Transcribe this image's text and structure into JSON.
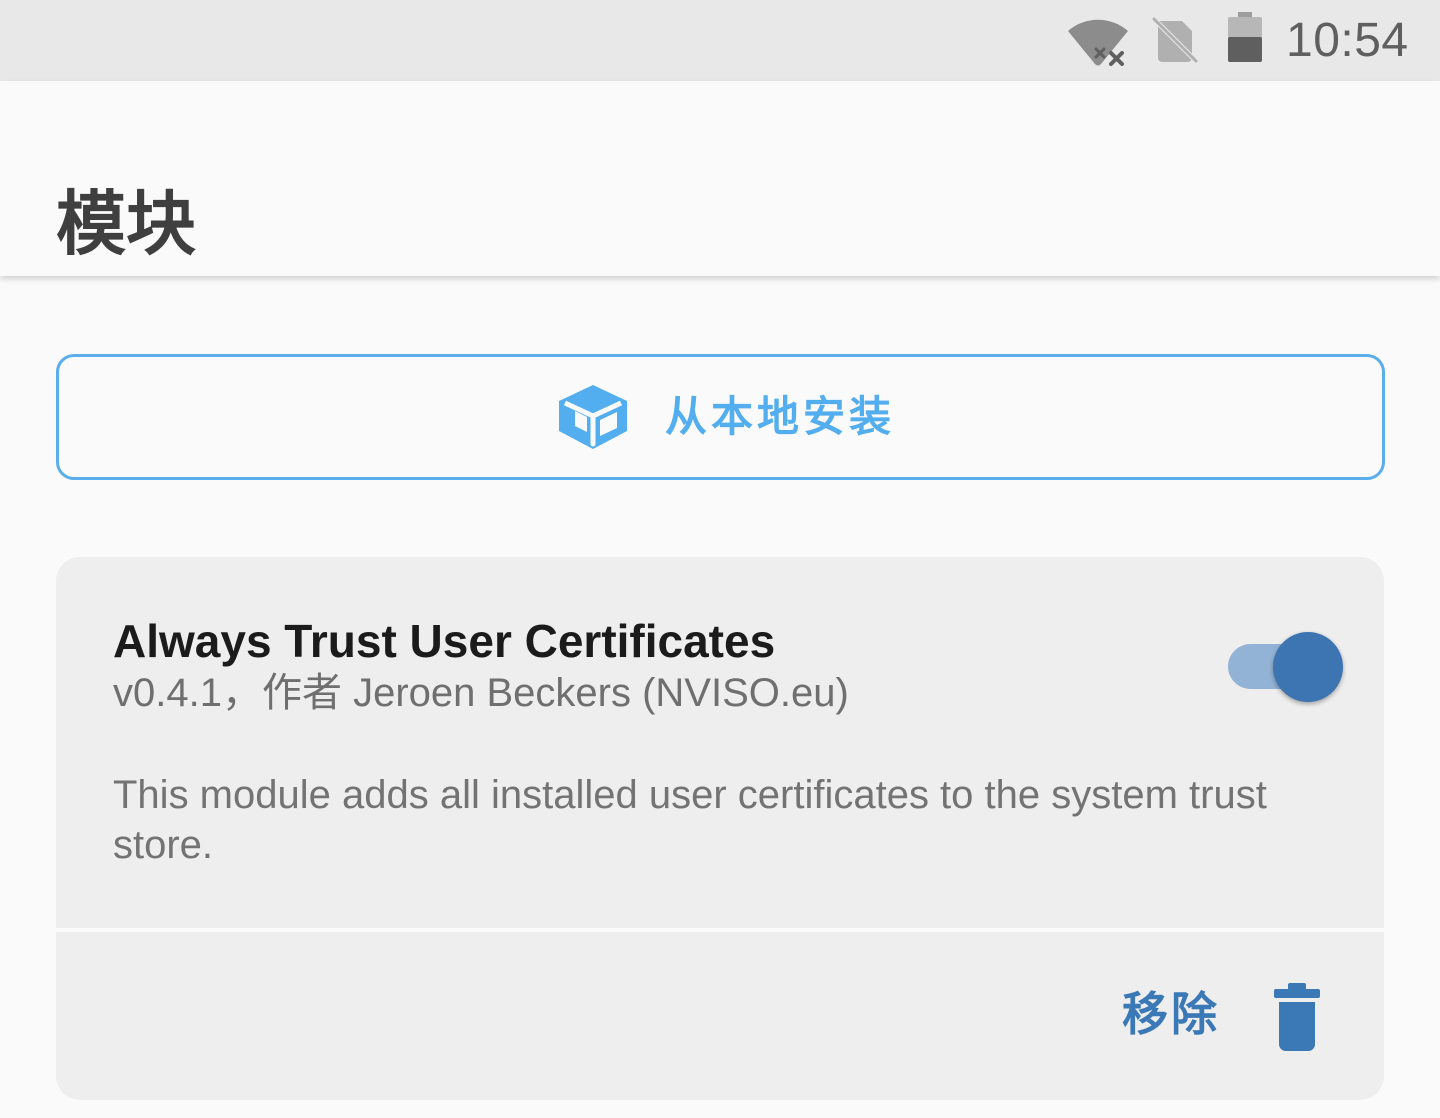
{
  "status_bar": {
    "time": "10:54",
    "icons": [
      "wifi-off-icon",
      "no-sim-icon",
      "battery-icon"
    ]
  },
  "app_bar": {
    "title": "模块"
  },
  "install_button": {
    "label": "从本地安装",
    "icon": "package-icon",
    "color": "#52aeee"
  },
  "module": {
    "title": "Always Trust User Certificates",
    "meta": "v0.4.1，作者 Jeroen Beckers (NVISO.eu)",
    "description": "This module adds all installed user certificates to the system trust store.",
    "enabled": true,
    "remove_label": "移除",
    "remove_icon": "trash-icon",
    "accent_color": "#3d75b3"
  }
}
